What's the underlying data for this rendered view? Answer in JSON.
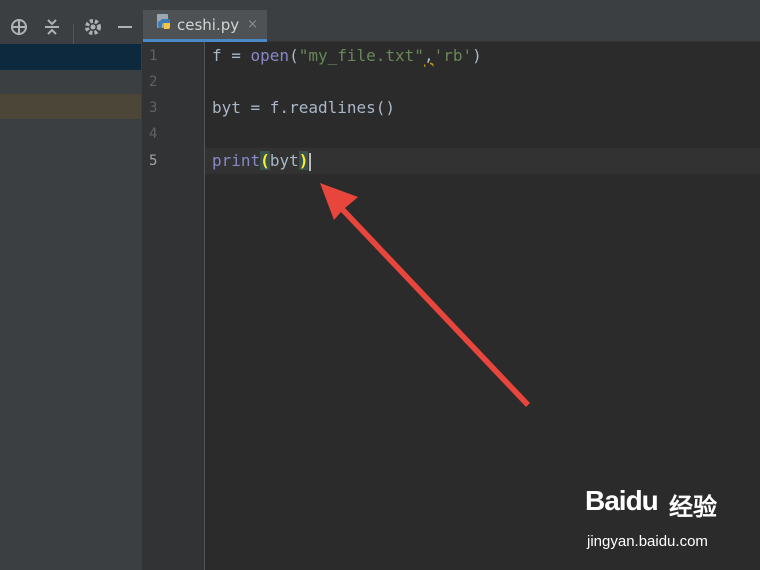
{
  "editor": {
    "tab": {
      "filename": "ceshi.py",
      "close_glyph": "×",
      "icon": "python-file-icon"
    },
    "line_numbers": [
      "1",
      "2",
      "3",
      "4",
      "5"
    ],
    "current_line": "5",
    "lines": {
      "l1": {
        "a": "f = ",
        "b": "open",
        "c": "(",
        "d": "\"my_file.txt\"",
        "e": ",",
        "f": "'rb'",
        "g": ")"
      },
      "l3": {
        "a": "byt = f.readlines()"
      },
      "l5": {
        "a": "print",
        "b": "(",
        "c": "byt",
        "d": ")"
      }
    }
  },
  "toolbar": {
    "icons": [
      "crosshair-icon",
      "collapse-icon",
      "gear-icon",
      "minimize-icon"
    ]
  },
  "annotation": {
    "type": "red-arrow",
    "color": "#e8453c"
  },
  "watermark": {
    "logo": "Baidu",
    "brand_cn": "经验",
    "url": "jingyan.baidu.com"
  },
  "colors": {
    "background": "#2b2b2b",
    "panel": "#3c3f41",
    "gutter": "#313335",
    "builtin": "#8888c6",
    "string": "#6a8759",
    "default_text": "#a9b7c6",
    "bracket_highlight": "#ffef28",
    "tab_underline": "#4a88c7"
  }
}
